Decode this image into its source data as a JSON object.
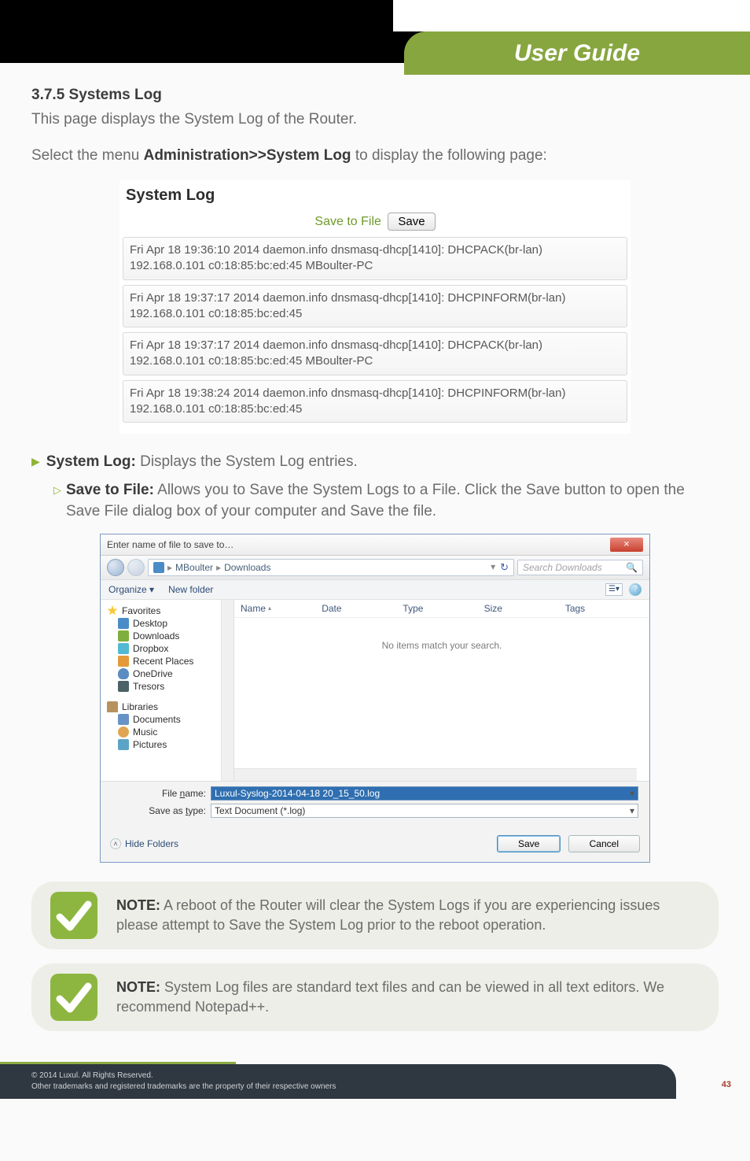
{
  "header": {
    "title": "User Guide"
  },
  "section": {
    "number_title": "3.7.5 Systems Log",
    "intro": "This page displays the System Log of the Router.",
    "select_pre": "Select the menu ",
    "select_bold": "Administration>>System Log",
    "select_post": " to display the following page:"
  },
  "syslog": {
    "title": "System Log",
    "save_label": "Save to File",
    "save_btn": "Save",
    "entries": [
      "Fri Apr 18 19:36:10 2014 daemon.info dnsmasq-dhcp[1410]: DHCPACK(br-lan) 192.168.0.101 c0:18:85:bc:ed:45 MBoulter-PC",
      "Fri Apr 18 19:37:17 2014 daemon.info dnsmasq-dhcp[1410]: DHCPINFORM(br-lan) 192.168.0.101 c0:18:85:bc:ed:45",
      "Fri Apr 18 19:37:17 2014 daemon.info dnsmasq-dhcp[1410]: DHCPACK(br-lan) 192.168.0.101 c0:18:85:bc:ed:45 MBoulter-PC",
      "Fri Apr 18 19:38:24 2014 daemon.info dnsmasq-dhcp[1410]: DHCPINFORM(br-lan) 192.168.0.101 c0:18:85:bc:ed:45"
    ]
  },
  "bullets": {
    "main_label": "System Log:",
    "main_text": " Displays the System Log entries.",
    "sub_label": "Save to File:",
    "sub_text": " Allows you to Save the System Logs to a File. Click the Save button to open the Save File dialog box of your computer and Save the file."
  },
  "save_dialog": {
    "window_title": "Enter name of file to save to…",
    "path_user": "MBoulter",
    "path_folder": "Downloads",
    "search_placeholder": "Search Downloads",
    "organize": "Organize ▾",
    "new_folder": "New folder",
    "columns": [
      "Name",
      "Date",
      "Type",
      "Size",
      "Tags"
    ],
    "empty_msg": "No items match your search.",
    "side": {
      "favorites": "Favorites",
      "desktop": "Desktop",
      "downloads": "Downloads",
      "dropbox": "Dropbox",
      "recent": "Recent Places",
      "onedrive": "OneDrive",
      "tresors": "Tresors",
      "libraries": "Libraries",
      "documents": "Documents",
      "music": "Music",
      "pictures": "Pictures"
    },
    "file_name_label_pre": "File ",
    "file_name_label_ul": "n",
    "file_name_label_post": "ame:",
    "file_name_value": "Luxul-Syslog-2014-04-18 20_15_50.log",
    "type_label_pre": "Save as ",
    "type_label_ul": "t",
    "type_label_post": "ype:",
    "type_value": "Text Document (*.log)",
    "hide_folders": "Hide Folders",
    "save_btn": "Save",
    "cancel_btn": "Cancel"
  },
  "notes": {
    "note_label": "NOTE:",
    "n1": " A reboot of the Router will clear the System Logs if you are experiencing issues please attempt to Save the System Log prior to the reboot operation.",
    "n2": " System Log files are standard text files and can be viewed in all text editors. We recommend Notepad++."
  },
  "footer": {
    "line1": "© 2014  Luxul. All Rights Reserved.",
    "line2": "Other trademarks and registered trademarks are the property of their respective owners",
    "page": "43"
  }
}
